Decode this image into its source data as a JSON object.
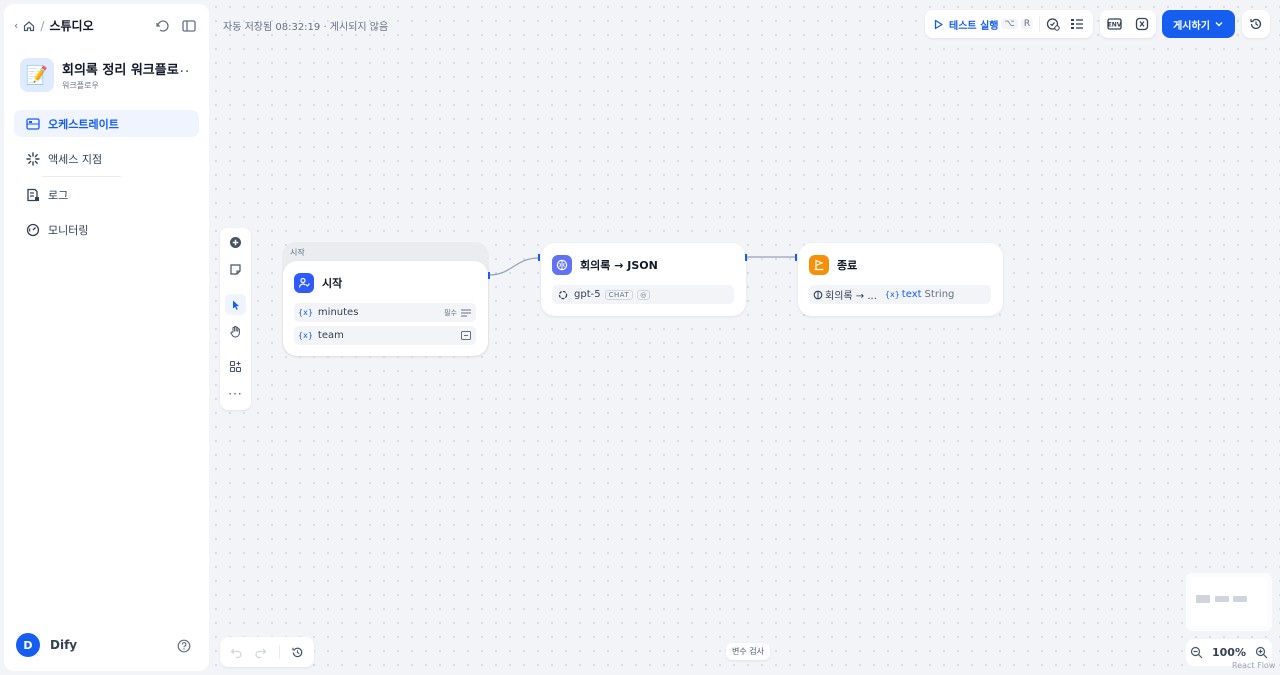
{
  "sidebar": {
    "breadcrumb": "스튜디오",
    "app": {
      "name": "회의록 정리 워크플로",
      "type": "워크플로우",
      "emoji": "📝"
    },
    "nav": [
      {
        "label": "오케스트레이트",
        "icon": "orchestrate-icon",
        "active": true
      },
      {
        "label": "액세스 지점",
        "icon": "access-point-icon"
      },
      {
        "label": "로그",
        "icon": "logs-icon"
      },
      {
        "label": "모니터링",
        "icon": "monitoring-icon"
      }
    ],
    "user": {
      "initial": "D",
      "name": "Dify"
    }
  },
  "header": {
    "autosave": "자동 저장됨 08:32:19 · 게시되지 않음",
    "test_run_label": "테스트 실행",
    "test_run_keys": [
      "⌥",
      "R"
    ],
    "publish_label": "게시하기"
  },
  "nodes": {
    "start": {
      "tag": "시작",
      "title": "시작",
      "variables": [
        {
          "name": "minutes",
          "required": "필수"
        },
        {
          "name": "team"
        }
      ]
    },
    "llm": {
      "title": "회의록 → JSON",
      "model": "gpt-5",
      "mode": "CHAT"
    },
    "end": {
      "title": "종료",
      "source_node": "회의록 → ...",
      "var_name": "text",
      "var_type": "String"
    }
  },
  "bottom": {
    "variable_inspect": "변수 검사",
    "zoom": "100%",
    "attribution": "React Flow"
  },
  "colors": {
    "accent": "#155eef",
    "start_icon": "#2e5bff",
    "llm_icon": "#6172f3",
    "end_icon": "#f79009"
  }
}
